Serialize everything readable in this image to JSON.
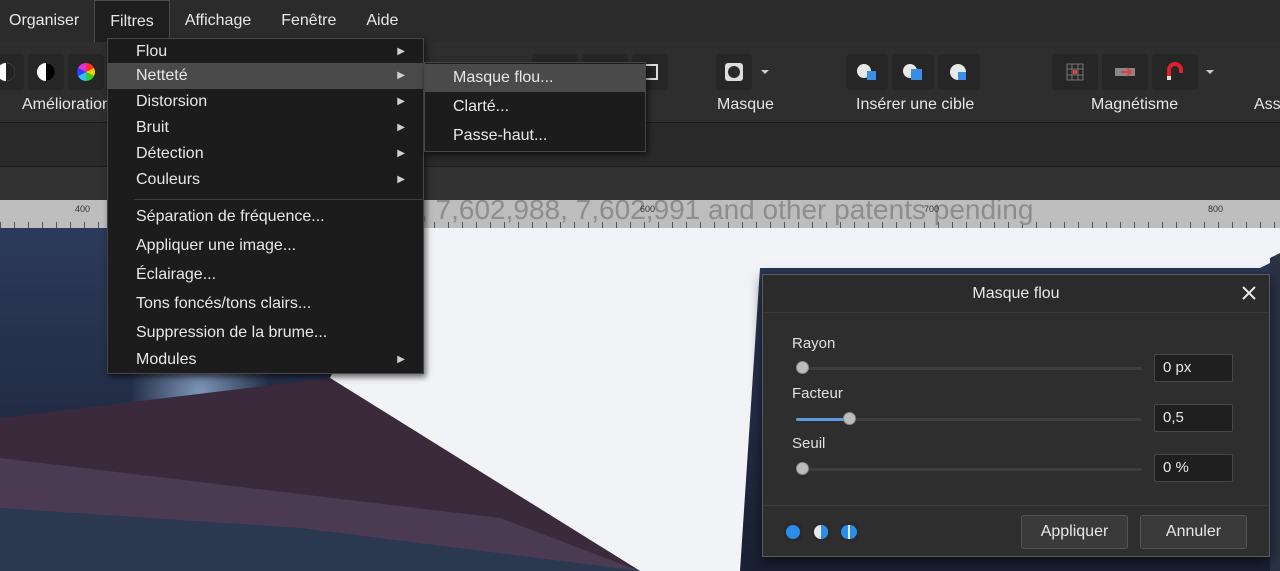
{
  "menubar": {
    "items": [
      "Organiser",
      "Filtres",
      "Affichage",
      "Fenêtre",
      "Aide"
    ],
    "open_item": "Filtres"
  },
  "toolbar": {
    "amelioration_label": "Amélioration",
    "masque_label": "Masque",
    "inserer_label": "Insérer une cible",
    "magnetisme_label": "Magnétisme",
    "ass_label": "Ass"
  },
  "ruler": {
    "ticks": [
      "400",
      "600",
      "700",
      "800"
    ],
    "ghost_text": ", 7,602,988, 7,602,991 and other patents pending"
  },
  "filtres_menu": {
    "items": [
      {
        "label": "Flou",
        "has_submenu": true
      },
      {
        "label": "Netteté",
        "has_submenu": true,
        "highlighted": true
      },
      {
        "label": "Distorsion",
        "has_submenu": true
      },
      {
        "label": "Bruit",
        "has_submenu": true
      },
      {
        "label": "Détection",
        "has_submenu": true
      },
      {
        "label": "Couleurs",
        "has_submenu": true
      },
      {
        "label": "Séparation de fréquence...",
        "has_submenu": false
      },
      {
        "label": "Appliquer une image...",
        "has_submenu": false
      },
      {
        "label": "Éclairage...",
        "has_submenu": false
      },
      {
        "label": "Tons foncés/tons clairs...",
        "has_submenu": false
      },
      {
        "label": "Suppression de la brume...",
        "has_submenu": false
      },
      {
        "label": "Modules",
        "has_submenu": true
      }
    ]
  },
  "nettete_submenu": {
    "items": [
      "Masque flou...",
      "Clarté...",
      "Passe-haut..."
    ],
    "highlighted": "Masque flou..."
  },
  "dialog": {
    "title": "Masque flou",
    "rayon_label": "Rayon",
    "rayon_value": "0 px",
    "rayon_fraction": 0.0,
    "facteur_label": "Facteur",
    "facteur_value": "0,5",
    "facteur_fraction": 0.14,
    "seuil_label": "Seuil",
    "seuil_value": "0 %",
    "seuil_fraction": 0.0,
    "apply_label": "Appliquer",
    "cancel_label": "Annuler"
  },
  "colors": {
    "accent": "#5a9ae0",
    "menu_bg": "#1c1c1c",
    "highlight": "#4a4a4a"
  }
}
